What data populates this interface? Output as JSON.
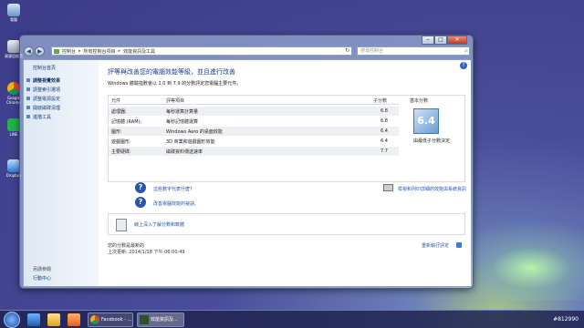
{
  "desktop": {
    "icons": [
      "電腦",
      "資源回收筒",
      "Google Chrome",
      "LINE",
      "Dropbox"
    ]
  },
  "window": {
    "breadcrumb": [
      "控制台",
      "所有控制台項目",
      "效能資訊及工具"
    ],
    "search_placeholder": "搜尋控制台",
    "caption": {
      "minimize": "–",
      "maximize": "□",
      "close": "✕"
    }
  },
  "sidebar": {
    "home": "控制台首頁",
    "items": [
      "調整視覺效果",
      "調整索引選項",
      "調整電源設定",
      "開啟磁碟清理",
      "進階工具"
    ],
    "see_also_label": "另請參閱",
    "see_also_link": "行動中心"
  },
  "main": {
    "heading": "評等與改善您的電腦效能等級，並且進行改善",
    "subtext": "Windows 體驗指數會以 1.0 到 7.9 的分數評定您電腦主要元件。",
    "table": {
      "headers": [
        "元件",
        "評等項目",
        "子分數",
        "基本分數"
      ],
      "rows": [
        {
          "component": "處理器:",
          "item": "每秒運算計算量",
          "score": "6.8"
        },
        {
          "component": "記憶體 (RAM):",
          "item": "每秒記憶體運算",
          "score": "6.8"
        },
        {
          "component": "圖形:",
          "item": "Windows Aero 的桌面效能",
          "score": "6.4"
        },
        {
          "component": "遊戲圖形:",
          "item": "3D 商業和遊戲圖形效能",
          "score": "6.4"
        },
        {
          "component": "主要硬碟:",
          "item": "磁碟資料傳送速率",
          "score": "7.7"
        }
      ],
      "base_score": "6.4",
      "base_caption": "由最低子分數決定"
    },
    "links": {
      "what_mean": "這些數字代表什麼?",
      "improve": "改善電腦效能的祕訣。",
      "print": "檢視和列印詳細的效能與系統資訊"
    },
    "online": {
      "text": "線上深入了解分數和軟體"
    },
    "last_updated_label": "您的分數是最新的",
    "last_updated": "上次更新: 2014/1/18 下午 06:00:49",
    "rerun": "重新執行評定"
  },
  "taskbar": {
    "tasks": [
      "Facebook - ...",
      "效能資訊及..."
    ],
    "tray_text": "#812990"
  },
  "colors": {
    "heading": "#1e3c8a",
    "link": "#1e55b3",
    "desktop": "#3b3b86"
  }
}
